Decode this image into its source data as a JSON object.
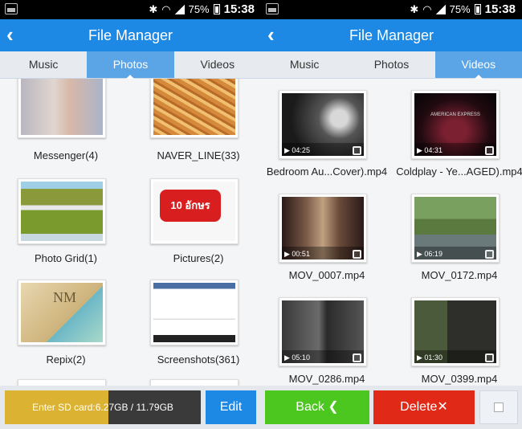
{
  "status": {
    "battery": "75%",
    "time": "15:38"
  },
  "title": "File Manager",
  "tabs": [
    "Music",
    "Photos",
    "Videos"
  ],
  "photos": [
    {
      "label": "Messenger(4)"
    },
    {
      "label": "NAVER_LINE(33)"
    },
    {
      "label": "Photo Grid(1)"
    },
    {
      "label": "Pictures(2)",
      "overlay": "10 อักษร"
    },
    {
      "label": "Repix(2)",
      "overlay": "NM"
    },
    {
      "label": "Screenshots(361)"
    }
  ],
  "videos": [
    {
      "label": "Bedroom Au...Cover).mp4",
      "duration": "04:25"
    },
    {
      "label": "Coldplay - Ye...AGED).mp4",
      "duration": "04:31",
      "overlay": "AMERICAN EXPRESS"
    },
    {
      "label": "MOV_0007.mp4",
      "duration": "00:51"
    },
    {
      "label": "MOV_0172.mp4",
      "duration": "06:19"
    },
    {
      "label": "MOV_0286.mp4",
      "duration": "05:10"
    },
    {
      "label": "MOV_0399.mp4",
      "duration": "01:30"
    }
  ],
  "storage": {
    "text": "Enter SD card:6.27GB / 11.79GB",
    "used_fraction": 0.53
  },
  "buttons": {
    "edit": "Edit",
    "back": "Back ❮",
    "delete": "Delete✕"
  },
  "colors": {
    "accent": "#1e88e5",
    "tab_active": "#5ba4e6",
    "back": "#4cc71f",
    "delete": "#e02a17",
    "storage": "#dbb231"
  }
}
